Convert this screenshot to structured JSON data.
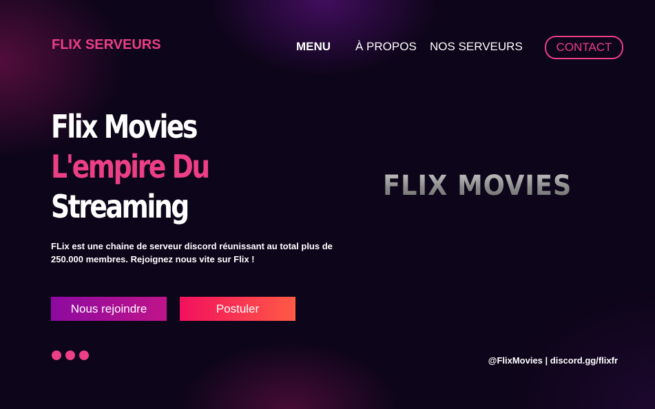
{
  "header": {
    "logo_text": "FLIX SERVEURS",
    "nav": {
      "menu": "MENU",
      "about": "À PROPOS",
      "servers": "NOS SERVEURS",
      "contact": "CONTACT"
    }
  },
  "hero": {
    "title_line1": "Flix Movies",
    "title_line2": "L'empire Du",
    "title_line3": "Streaming",
    "description": "FLix est une chaine de serveur discord réunissant au total plus de 250.000 membres. Rejoignez nous vite sur Flix !",
    "join_button": "Nous rejoindre",
    "apply_button": "Postuler"
  },
  "brand_image_text": "FLIX MOVIES",
  "footer": {
    "social_text": "@FlixMovies | discord.gg/flixfr"
  },
  "colors": {
    "accent_pink": "#ec3f86",
    "background": "#0d0519",
    "join_button_gradient": [
      "#8c0aa0",
      "#c0148a"
    ],
    "apply_button_gradient": [
      "#f2105e",
      "#ff5a46"
    ]
  },
  "carousel": {
    "dot_count": 3
  }
}
